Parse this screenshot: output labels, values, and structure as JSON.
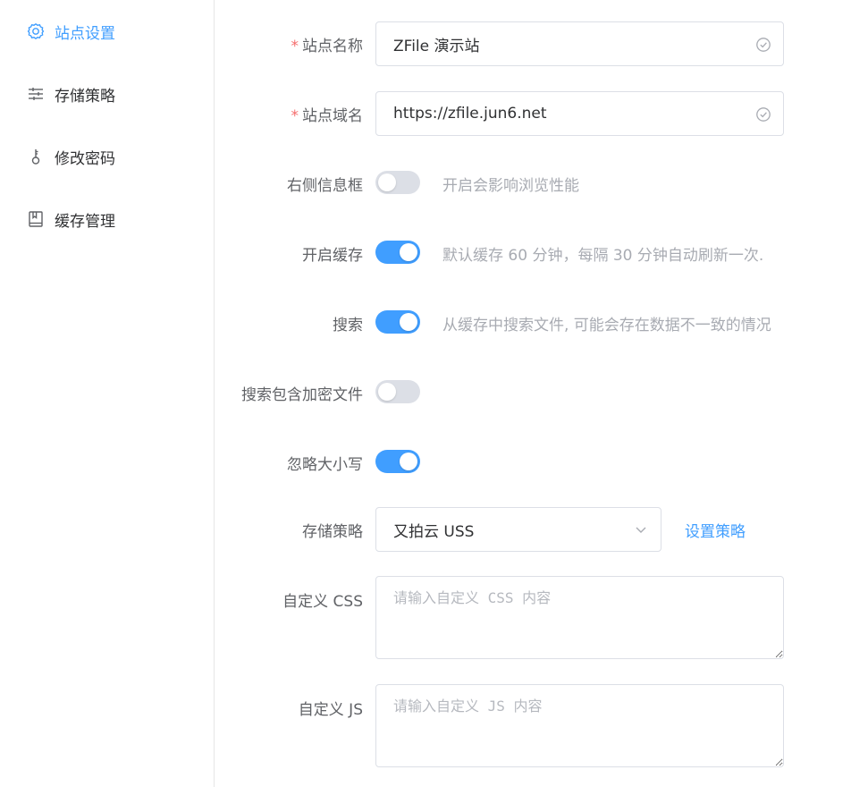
{
  "sidebar": {
    "items": [
      {
        "label": "站点设置",
        "icon": "gear-icon",
        "active": true
      },
      {
        "label": "存储策略",
        "icon": "sliders-icon",
        "active": false
      },
      {
        "label": "修改密码",
        "icon": "key-icon",
        "active": false
      },
      {
        "label": "缓存管理",
        "icon": "book-icon",
        "active": false
      }
    ]
  },
  "form": {
    "site_name": {
      "label": "站点名称",
      "required_mark": "*",
      "value": "ZFile 演示站"
    },
    "site_domain": {
      "label": "站点域名",
      "required_mark": "*",
      "value": "https://zfile.jun6.net"
    },
    "right_info": {
      "label": "右侧信息框",
      "enabled": false,
      "hint": "开启会影响浏览性能"
    },
    "cache": {
      "label": "开启缓存",
      "enabled": true,
      "hint": "默认缓存 60 分钟，每隔 30 分钟自动刷新一次."
    },
    "search": {
      "label": "搜索",
      "enabled": true,
      "hint": "从缓存中搜索文件, 可能会存在数据不一致的情况"
    },
    "search_encrypted": {
      "label": "搜索包含加密文件",
      "enabled": false
    },
    "ignore_case": {
      "label": "忽略大小写",
      "enabled": true
    },
    "storage": {
      "label": "存储策略",
      "value": "又拍云 USS",
      "link": "设置策略"
    },
    "custom_css": {
      "label": "自定义 CSS",
      "placeholder": "请输入自定义 CSS 内容"
    },
    "custom_js": {
      "label": "自定义 JS",
      "placeholder": "请输入自定义 JS 内容"
    }
  },
  "colors": {
    "accent": "#409eff",
    "required": "#f56c6c",
    "border": "#dcdfe6"
  }
}
